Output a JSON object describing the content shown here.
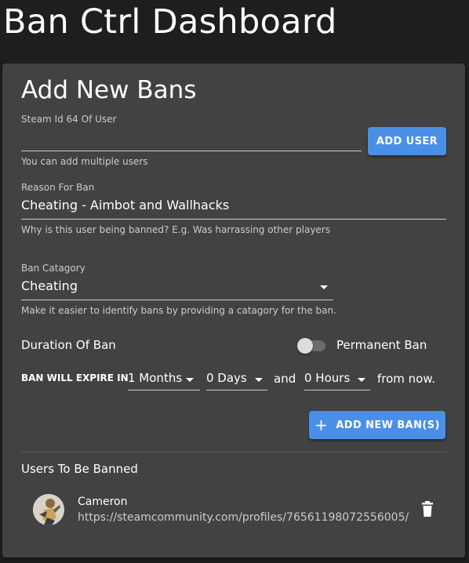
{
  "page": {
    "title": "Ban Ctrl Dashboard"
  },
  "card": {
    "title": "Add New Bans"
  },
  "steam_id": {
    "label": "Steam Id 64 Of User",
    "value": "",
    "hint": "You can add multiple users",
    "button_label": "ADD USER"
  },
  "reason": {
    "label": "Reason For Ban",
    "value": "Cheating - Aimbot and Wallhacks",
    "hint": "Why is this user being banned? E.g. Was harrassing other players"
  },
  "category": {
    "label": "Ban Catagory",
    "value": "Cheating",
    "hint": "Make it easier to identify bans by providing a catagory for the ban."
  },
  "duration": {
    "label": "Duration Of Ban",
    "permanent_label": "Permanent Ban",
    "permanent_on": false,
    "expire_label": "BAN WILL EXPIRE IN",
    "months_value": "1 Months",
    "days_value": "0 Days",
    "and_label": "and",
    "hours_value": "0 Hours",
    "suffix_label": "from now."
  },
  "add_bans_button": {
    "label": "ADD NEW BAN(S)",
    "icon": "plus-icon"
  },
  "users_section": {
    "title": "Users To Be Banned",
    "users": [
      {
        "name": "Cameron",
        "url": "https://steamcommunity.com/profiles/76561198072556005/",
        "delete_icon": "trash-icon"
      }
    ]
  },
  "colors": {
    "background": "#1e1e1e",
    "card": "#424242",
    "accent": "#4a8fe7"
  }
}
